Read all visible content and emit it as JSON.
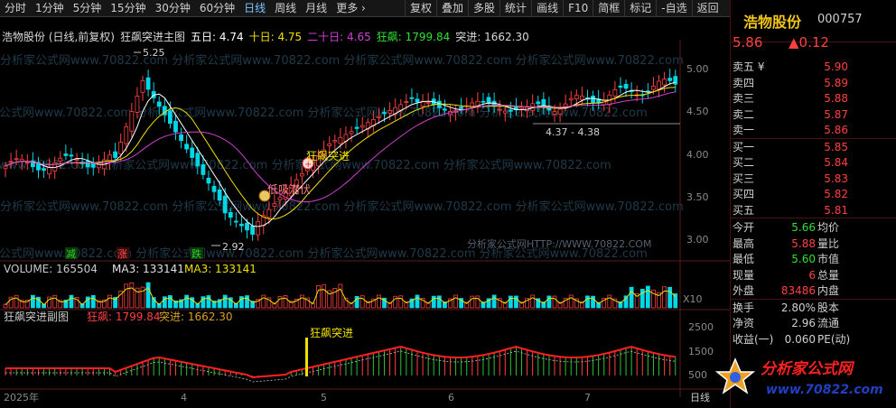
{
  "toolbar": {
    "periods": [
      "分时",
      "1分钟",
      "5分钟",
      "15分钟",
      "30分钟",
      "60分钟",
      "日线",
      "周线",
      "月线",
      "更多 ›"
    ],
    "active_period": "日线",
    "actions": [
      "复权",
      "叠加",
      "多股",
      "统计",
      "画线",
      "F10",
      "简框",
      "标记",
      "-自选",
      "返回"
    ]
  },
  "main_chart": {
    "title": "浩物股份 (日线,前复权)",
    "indicator_name": "狂飙突进主图",
    "ma5_label": "五日: 4.74",
    "ma10_label": "十日: 4.75",
    "ma20_label": "二十日: 4.65",
    "kuangbiao_label": "狂飙: 1799.84",
    "tujin_label": "突进: 1662.30",
    "price_axis": [
      "5.00",
      "4.50",
      "4.00",
      "3.50",
      "3.00"
    ],
    "high_label": "5.25",
    "low_label": "2.92",
    "range_label": "4.37 - 4.38",
    "annot_tupo": "狂飙突进",
    "annot_dixi": "低吸潜伏",
    "tag_jian": "减",
    "tag_zhang": "涨",
    "tag_die": "跌",
    "watermark_row": "分析家公式网www.70822.com 分析家公式网www.70822.com 分析家公式网www.70822.com 分析家公式网www.70822.com",
    "watermark_bottom": "分析家公式网HTTP://WWW.70822.COM"
  },
  "volume_chart": {
    "volume_label": "VOLUME: 165504",
    "ma3_label_white": "MA3: 133141",
    "ma3_label_yellow": "MA3: 133141",
    "unit": "X10"
  },
  "sub_chart": {
    "name": "狂飙突进副图",
    "kuangbiao_label": "狂飙: 1799.84",
    "tujin_label": "突进: 1662.30",
    "axis": [
      "2500",
      "1500",
      "500"
    ],
    "signal_label": "狂飙突进"
  },
  "time_axis": [
    "2025年",
    "4",
    "5",
    "6",
    "7"
  ],
  "time_axis_suffix": "日线",
  "side_panel": {
    "name": "浩物股份",
    "code": "000757",
    "price": "5.86",
    "change": "▲0.12",
    "asks": [
      {
        "label": "卖五 ¥",
        "price": "5.90"
      },
      {
        "label": "卖四",
        "price": "5.89"
      },
      {
        "label": "卖三",
        "price": "5.88"
      },
      {
        "label": "卖二",
        "price": "5.87"
      },
      {
        "label": "卖一",
        "price": "5.86"
      }
    ],
    "bids": [
      {
        "label": "买一",
        "price": "5.85"
      },
      {
        "label": "买二",
        "price": "5.84"
      },
      {
        "label": "买三",
        "price": "5.83"
      },
      {
        "label": "买四",
        "price": "5.82"
      },
      {
        "label": "买五",
        "price": "5.81"
      }
    ],
    "stats": [
      {
        "k1": "今开",
        "v1": "5.66",
        "k2": "均价"
      },
      {
        "k1": "最高",
        "v1": "5.88",
        "k2": "量比"
      },
      {
        "k1": "最低",
        "v1": "5.60",
        "k2": "市值"
      },
      {
        "k1": "现量",
        "v1": "6",
        "k2": "总量"
      },
      {
        "k1": "外盘",
        "v1": "83486",
        "k2": "内盘"
      }
    ],
    "stats2": [
      {
        "k1": "换手",
        "v1": "2.80%",
        "k2": "股本"
      },
      {
        "k1": "净资",
        "v1": "2.96",
        "k2": "流通"
      },
      {
        "k1": "收益(一)",
        "v1": "0.060",
        "k2": "PE(动)"
      }
    ]
  },
  "logo": {
    "line1": "分析家公式网",
    "line2": "www.70822.com"
  },
  "colors": {
    "up": "#ff4040",
    "down": "#00d8e8",
    "ma5": "#ffffff",
    "ma10": "#f0e000",
    "ma20": "#d040d0",
    "accent": "#f0c419"
  }
}
